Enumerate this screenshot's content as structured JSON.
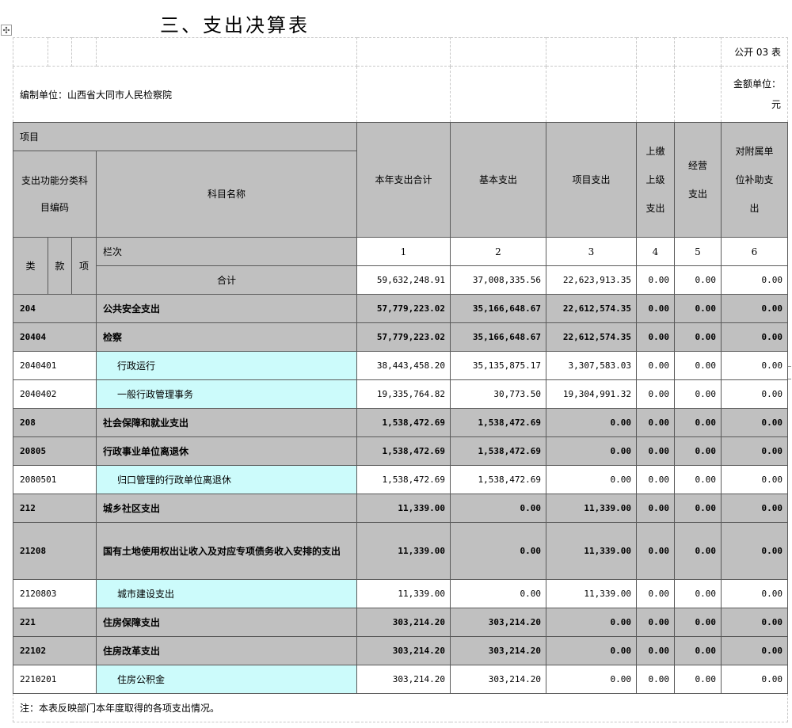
{
  "title": "三、支出决算表",
  "form_code": "公开 03 表",
  "org_label": "编制单位：山西省大同市人民检察院",
  "unit_label": "金额单位：",
  "unit_value": "元",
  "header": {
    "item": "项目",
    "func_code": "支出功能分类科目编码",
    "subject_name": "科目名称",
    "total": "本年支出合计",
    "basic": "基本支出",
    "project": "项目支出",
    "upper": "上缴上级支出",
    "business": "经营支出",
    "subsidy": "对附属单位补助支出",
    "lei": "类",
    "kuan": "款",
    "xiang": "项",
    "lanci": "栏次",
    "cols": [
      "1",
      "2",
      "3",
      "4",
      "5",
      "6"
    ],
    "heji": "合计"
  },
  "totals": [
    "59,632,248.91",
    "37,008,335.56",
    "22,623,913.35",
    "0.00",
    "0.00",
    "0.00"
  ],
  "rows": [
    {
      "code": "204",
      "name": "公共安全支出",
      "level": "grey",
      "v": [
        "57,779,223.02",
        "35,166,648.67",
        "22,612,574.35",
        "0.00",
        "0.00",
        "0.00"
      ]
    },
    {
      "code": "20404",
      "name": "检察",
      "level": "grey",
      "v": [
        "57,779,223.02",
        "35,166,648.67",
        "22,612,574.35",
        "0.00",
        "0.00",
        "0.00"
      ]
    },
    {
      "code": "2040401",
      "name": "行政运行",
      "level": "white",
      "v": [
        "38,443,458.20",
        "35,135,875.17",
        "3,307,583.03",
        "0.00",
        "0.00",
        "0.00"
      ]
    },
    {
      "code": "2040402",
      "name": "一般行政管理事务",
      "level": "white",
      "v": [
        "19,335,764.82",
        "30,773.50",
        "19,304,991.32",
        "0.00",
        "0.00",
        "0.00"
      ]
    },
    {
      "code": "208",
      "name": "社会保障和就业支出",
      "level": "grey",
      "v": [
        "1,538,472.69",
        "1,538,472.69",
        "0.00",
        "0.00",
        "0.00",
        "0.00"
      ]
    },
    {
      "code": "20805",
      "name": "行政事业单位离退休",
      "level": "grey",
      "v": [
        "1,538,472.69",
        "1,538,472.69",
        "0.00",
        "0.00",
        "0.00",
        "0.00"
      ]
    },
    {
      "code": "2080501",
      "name": "归口管理的行政单位离退休",
      "level": "white",
      "v": [
        "1,538,472.69",
        "1,538,472.69",
        "0.00",
        "0.00",
        "0.00",
        "0.00"
      ]
    },
    {
      "code": "212",
      "name": "城乡社区支出",
      "level": "grey",
      "v": [
        "11,339.00",
        "0.00",
        "11,339.00",
        "0.00",
        "0.00",
        "0.00"
      ]
    },
    {
      "code": "21208",
      "name": "国有土地使用权出让收入及对应专项债务收入安排的支出",
      "level": "grey",
      "v": [
        "11,339.00",
        "0.00",
        "11,339.00",
        "0.00",
        "0.00",
        "0.00"
      ]
    },
    {
      "code": "2120803",
      "name": "城市建设支出",
      "level": "white",
      "v": [
        "11,339.00",
        "0.00",
        "11,339.00",
        "0.00",
        "0.00",
        "0.00"
      ]
    },
    {
      "code": "221",
      "name": "住房保障支出",
      "level": "grey",
      "v": [
        "303,214.20",
        "303,214.20",
        "0.00",
        "0.00",
        "0.00",
        "0.00"
      ]
    },
    {
      "code": "22102",
      "name": "住房改革支出",
      "level": "grey",
      "v": [
        "303,214.20",
        "303,214.20",
        "0.00",
        "0.00",
        "0.00",
        "0.00"
      ]
    },
    {
      "code": "2210201",
      "name": "住房公积金",
      "level": "white",
      "v": [
        "303,214.20",
        "303,214.20",
        "0.00",
        "0.00",
        "0.00",
        "0.00"
      ]
    }
  ],
  "note": "注：本表反映部门本年度取得的各项支出情况。"
}
